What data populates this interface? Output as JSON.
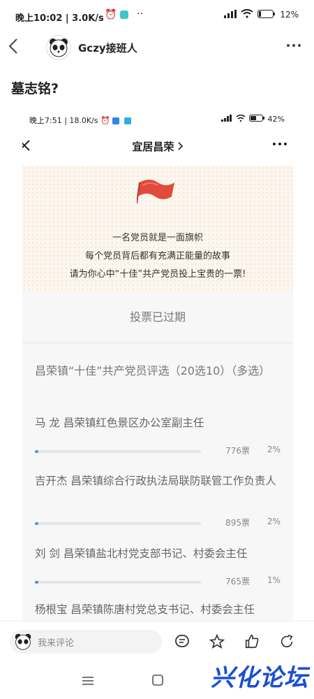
{
  "status_bar": {
    "time": "晚上10:02 | 3.0K/s",
    "battery": "12%"
  },
  "header": {
    "username": "Gczy接班人"
  },
  "post": {
    "title": "墓志铭?"
  },
  "inner": {
    "status_bar": {
      "time": "晚上7:51 | 18.0K/s",
      "battery": "42%"
    },
    "nav_title": "宜居昌荣",
    "slogans": [
      "一名党员就是一面旗帜",
      "每个党员背后都有充满正能量的故事",
      "请为你心中“十佳”共产党员投上宝贵的一票!"
    ],
    "vote": {
      "status": "投票已过期",
      "question": "昌荣镇“十佳”共产党员评选（20选10）（多选）",
      "candidates": [
        {
          "name": "马 龙 昌荣镇红色景区办公室副主任",
          "votes": "776票",
          "pct": "2%",
          "share": 0.02
        },
        {
          "name": "吉开杰 昌荣镇综合行政执法局联防联管工作负责人",
          "votes": "895票",
          "pct": "2%",
          "share": 0.02
        },
        {
          "name": "刘 剑 昌荣镇盐北村党支部书记、村委会主任",
          "votes": "765票",
          "pct": "1%",
          "share": 0.01
        },
        {
          "name": "杨根宝 昌荣镇陈唐村党总支书记、村委会主任"
        }
      ]
    }
  },
  "bottom": {
    "comment_placeholder": "我来评论"
  },
  "watermark": "兴化论坛",
  "colors": {
    "accent": "#5b8fd6",
    "watermark": "#1b4fd1",
    "flag": "#e24a3b"
  }
}
